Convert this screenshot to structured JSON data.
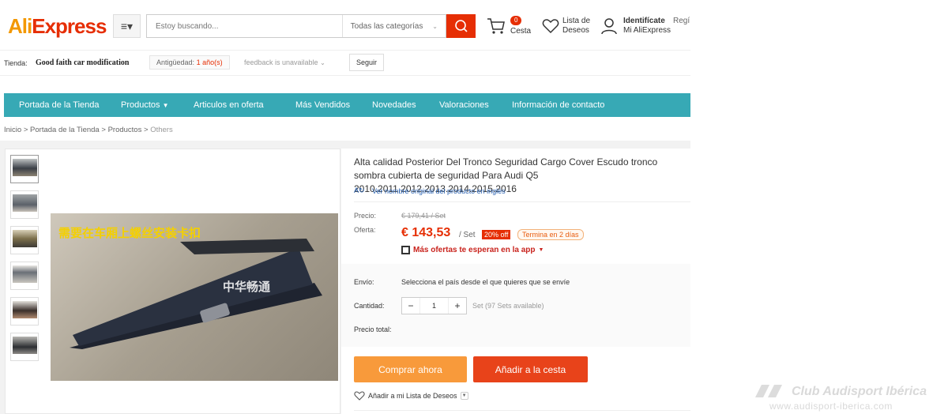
{
  "header": {
    "logo_text": "AliExpress",
    "search_placeholder": "Estoy buscando...",
    "search_category": "Todas las categorías",
    "cart_count": "0",
    "cart_label": "Cesta",
    "wishlist_line1": "Lista de",
    "wishlist_line2": "Deseos",
    "account_line1": "Identifícate",
    "account_line2": "Mi AliExpress",
    "register": "Regí"
  },
  "store": {
    "label": "Tienda:",
    "name": "Good faith car modification",
    "seniority_label": "Antigüedad:",
    "seniority_value": "1 año(s)",
    "feedback": "feedback is unavailable",
    "follow": "Seguir"
  },
  "store_nav": [
    "Portada de la Tienda",
    "Productos",
    "Articulos en oferta",
    "Más Vendidos",
    "Novedades",
    "Valoraciones",
    "Información de contacto"
  ],
  "breadcrumb": {
    "home": "Inicio",
    "store_home": "Portada de la Tienda",
    "products": "Productos",
    "current": "Others",
    "sep": ">"
  },
  "product": {
    "title": "Alta calidad Posterior Del Tronco Seguridad Cargo Cover Escudo tronco sombra cubierta de seguridad Para Audi Q5 2010.2011.2012.2013.2014.2015.2016",
    "original_name_link": "Ver nombre original del producto en inglés",
    "image_overlay_text": "需要在车厢上螺丝安装卡扣",
    "image_watermark": "中华畅通",
    "price_label": "Precio:",
    "price_old": "€ 179,41 / Set",
    "offer_label": "Oferta:",
    "price_new": "€ 143,53",
    "per_set": "/ Set",
    "discount": "20% off",
    "ends": "Termina en 2 días",
    "app_offer": "Más ofertas te esperan en la app",
    "shipping_label": "Envío:",
    "shipping_value": "Selecciona el país desde el que quieres que se envíe",
    "quantity_label": "Cantidad:",
    "quantity_value": "1",
    "quantity_minus": "−",
    "quantity_plus": "+",
    "availability": "Set (97 Sets available)",
    "total_label": "Precio total:",
    "buy_now": "Comprar ahora",
    "add_to_cart": "Añadir a la cesta",
    "add_to_wishlist": "Añadir a mi Lista de Deseos"
  },
  "site_watermark": {
    "name": "Club Audisport Ibérica",
    "url": "www.audisport-iberica.com"
  },
  "colors": {
    "brand_red": "#e62e04",
    "brand_orange": "#f39800",
    "store_nav_bg": "#37a9b5",
    "buy_now_bg": "#f89a3b",
    "add_cart_bg": "#e8431a"
  }
}
